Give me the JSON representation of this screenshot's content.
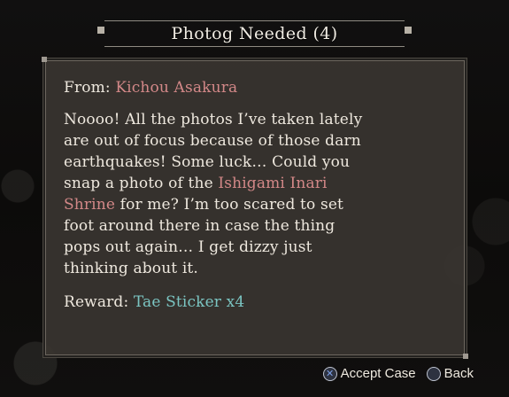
{
  "title": "Photog Needed (4)",
  "dialog": {
    "from_label": "From: ",
    "from_name": "Kichou Asakura",
    "message_lines": [
      "Noooo! All the photos I’ve taken lately",
      "are out of focus because of those darn",
      "earthquakes! Some luck… Could you",
      "snap a photo of the ",
      "Ishigami Inari",
      "Shrine",
      " for me? I’m too scared to set",
      "foot around there in case the thing",
      "pops out again… I get dizzy just",
      "thinking about it."
    ],
    "reward_label": "Reward: ",
    "reward_value": "Tae Sticker x4"
  },
  "controls": {
    "accept_label": "Accept Case",
    "back_label": "Back"
  },
  "colors": {
    "highlight_pink": "#d38888",
    "highlight_teal": "#7bc5c2"
  },
  "icons": {
    "accept": "cross-button-icon",
    "back": "circle-button-icon"
  }
}
